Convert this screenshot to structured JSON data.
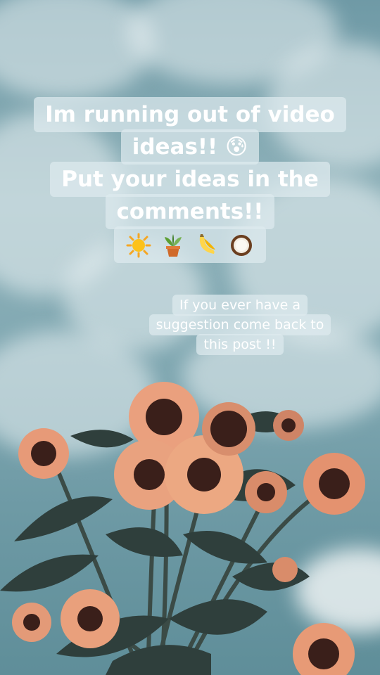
{
  "caption": {
    "lines": [
      "Im running out of video",
      "ideas!! 😰",
      "Put your ideas in the",
      "comments!!"
    ],
    "emoji_line_icons": [
      "sun-icon",
      "potted-plant-icon",
      "banana-icon",
      "coconut-icon"
    ]
  },
  "subcaption": {
    "lines": [
      "If you ever have a",
      "suggestion come back to",
      "this post !!"
    ]
  }
}
